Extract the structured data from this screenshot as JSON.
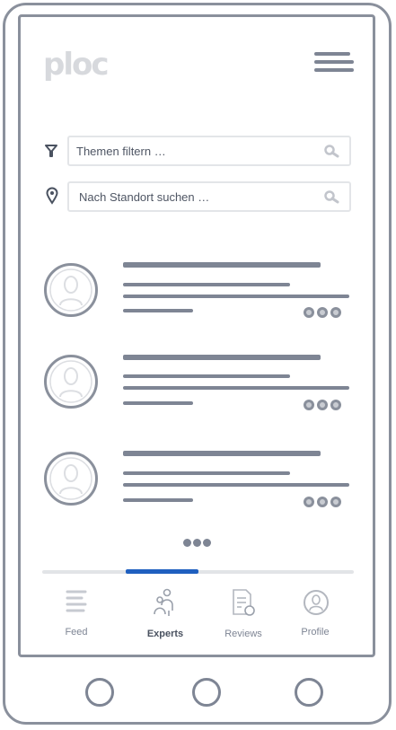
{
  "app": {
    "logo": "ploc"
  },
  "search": {
    "topic_placeholder": "Themen filtern  …",
    "location_placeholder": "Nach Standort suchen …"
  },
  "experts": [
    {
      "id": 1
    },
    {
      "id": 2
    },
    {
      "id": 3
    }
  ],
  "tabs": {
    "feed": "Feed",
    "experts": "Experts",
    "reviews": "Reviews",
    "profile": "Profile"
  },
  "tab_indicator": {
    "active_index": 1,
    "count": 4
  },
  "colors": {
    "accent": "#1f5fbf",
    "line_dark": "#7e8594",
    "line_light": "#c7cad1"
  }
}
